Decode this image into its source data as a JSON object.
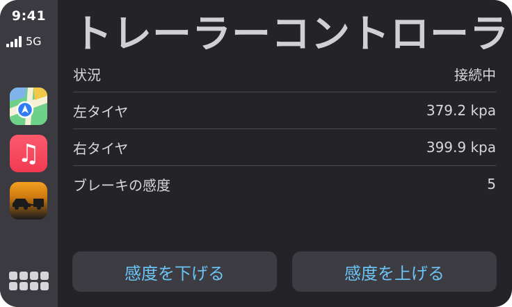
{
  "status": {
    "time": "9:41",
    "network": "5G"
  },
  "sidebar": {
    "apps": [
      {
        "name": "maps-app-icon"
      },
      {
        "name": "music-app-icon",
        "glyph": "♫"
      },
      {
        "name": "trailer-app-icon"
      }
    ]
  },
  "main": {
    "title": "トレーラーコントローラ",
    "rows": [
      {
        "label": "状況",
        "value": "接続中"
      },
      {
        "label": "左タイヤ",
        "value": "379.2 kpa"
      },
      {
        "label": "右タイヤ",
        "value": "399.9 kpa"
      },
      {
        "label": "ブレーキの感度",
        "value": "5"
      }
    ],
    "buttons": {
      "decrease": "感度を下げる",
      "increase": "感度を上げる"
    }
  },
  "colors": {
    "background": "#232328",
    "sidebar": "#3a3a40",
    "accent": "#6cc4f6",
    "button": "#3c3c42"
  }
}
